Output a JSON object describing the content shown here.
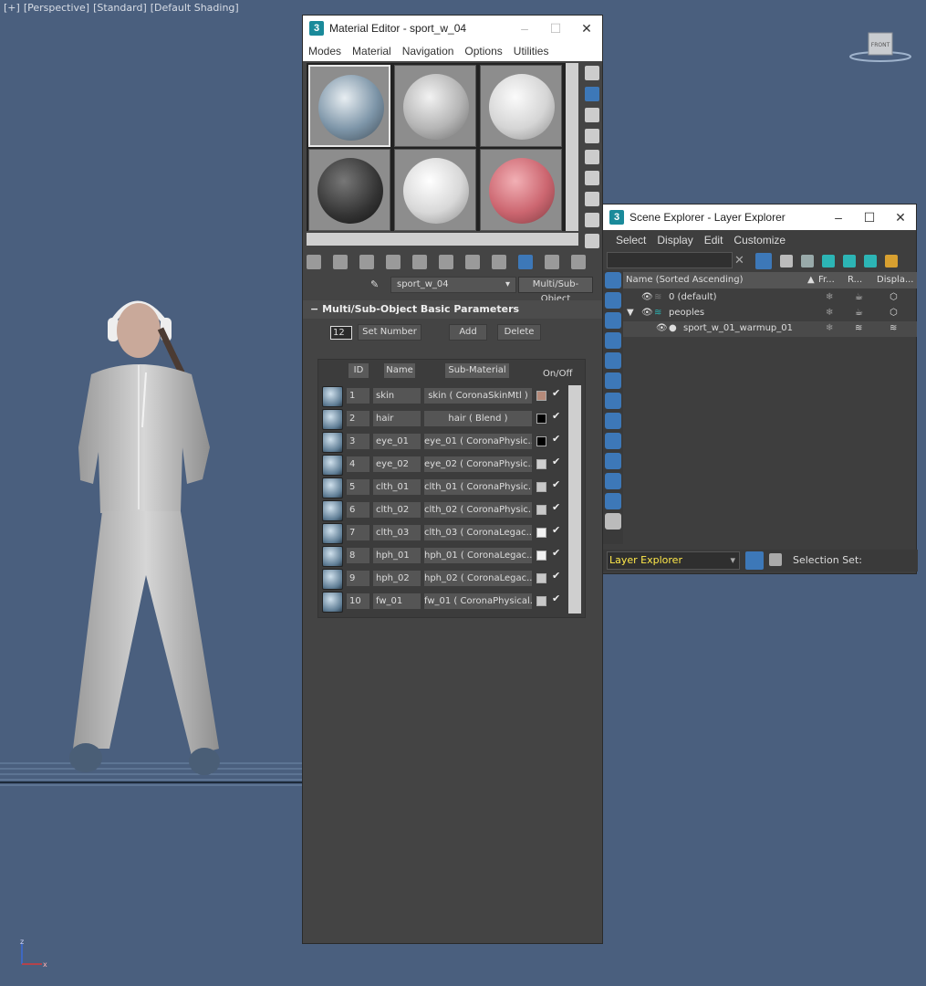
{
  "viewport": {
    "labels": [
      "[+]",
      "[Perspective]",
      "[Standard]",
      "[Default Shading]"
    ],
    "viewcube_label": "FRONT",
    "axis_x": "x",
    "axis_z": "z"
  },
  "material_editor": {
    "title": "Material Editor - sport_w_04",
    "menu": [
      "Modes",
      "Material",
      "Navigation",
      "Options",
      "Utilities"
    ],
    "material_name": "sport_w_04",
    "material_type": "Multi/Sub-Object",
    "rollout_title": "Multi/Sub-Object Basic Parameters",
    "num_materials": "12",
    "set_number_label": "Set Number",
    "add_label": "Add",
    "delete_label": "Delete",
    "columns": {
      "id": "ID",
      "name": "Name",
      "sub": "Sub-Material",
      "onoff": "On/Off"
    },
    "rows": [
      {
        "id": "1",
        "name": "skin",
        "sub": "skin  ( CoronaSkinMtl )",
        "color": "#b58a7a"
      },
      {
        "id": "2",
        "name": "hair",
        "sub": "hair  ( Blend )",
        "color": "#000000"
      },
      {
        "id": "3",
        "name": "eye_01",
        "sub": "eye_01  (  CoronaPhysic...",
        "color": "#000000"
      },
      {
        "id": "4",
        "name": "eye_02",
        "sub": "eye_02  (  CoronaPhysic...",
        "color": "#d0d0d0"
      },
      {
        "id": "5",
        "name": "clth_01",
        "sub": "clth_01  (  CoronaPhysic...",
        "color": "#c8c8c8"
      },
      {
        "id": "6",
        "name": "clth_02",
        "sub": "clth_02  (  CoronaPhysic...",
        "color": "#c8c8c8"
      },
      {
        "id": "7",
        "name": "clth_03",
        "sub": "clth_03  ( CoronaLegac...",
        "color": "#f2f2f2"
      },
      {
        "id": "8",
        "name": "hph_01",
        "sub": "hph_01  ( CoronaLegac...",
        "color": "#f2f2f2"
      },
      {
        "id": "9",
        "name": "hph_02",
        "sub": "hph_02  ( CoronaLegac...",
        "color": "#c8c8c8"
      },
      {
        "id": "10",
        "name": "fw_01",
        "sub": "fw_01  (  CoronaPhysical...",
        "color": "#c8c8c8"
      }
    ]
  },
  "scene_explorer": {
    "title": "Scene Explorer - Layer Explorer",
    "menu": [
      "Select",
      "Display",
      "Edit",
      "Customize"
    ],
    "columns": {
      "name": "Name (Sorted Ascending)",
      "fr": "Fr...",
      "r": "R...",
      "disp": "Displa..."
    },
    "layers": [
      {
        "name": "0 (default)"
      },
      {
        "name": "peoples"
      },
      {
        "name": "sport_w_01_warmup_01"
      }
    ],
    "mode": "Layer Explorer",
    "selection_set_label": "Selection Set:"
  },
  "colors": {
    "viewport_bg": "#4a5f7e",
    "panel_bg": "#444444",
    "accent_blue": "#3d78b8",
    "highlight_yellow": "#ffe94a"
  }
}
